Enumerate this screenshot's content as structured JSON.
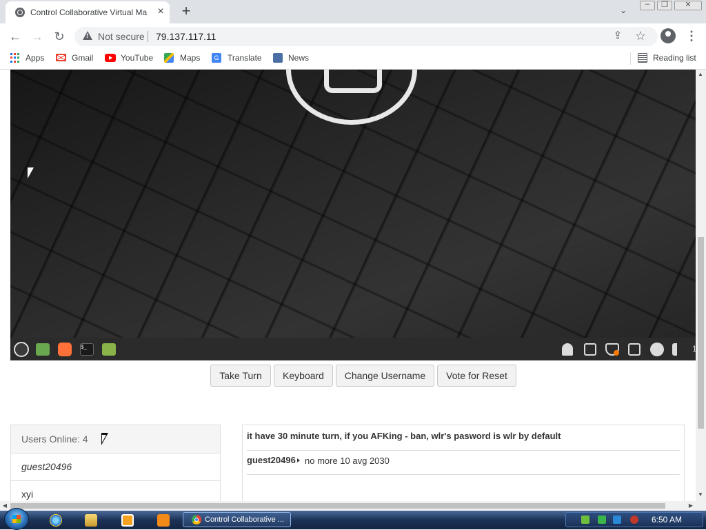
{
  "browser": {
    "tab": {
      "title": "Control Collaborative Virtual Ma",
      "close_icon": "×"
    },
    "new_tab_icon": "+",
    "tab_search_icon": "⌄",
    "window_controls": {
      "minimize": "–",
      "restore": "❐",
      "close": "✕"
    },
    "nav": {
      "back": "←",
      "forward": "→",
      "reload": "↻"
    },
    "omnibox": {
      "security_label": "Not secure",
      "url": "79.137.117.11",
      "share_icon": "⇪",
      "star_icon": "☆"
    },
    "menu_icon": "⋮",
    "bookmarks": [
      {
        "label": "Apps",
        "icon": "apps-grid-icon",
        "color": "#1a73e8"
      },
      {
        "label": "Gmail",
        "icon": "gmail-icon",
        "color": "#ea4335"
      },
      {
        "label": "YouTube",
        "icon": "youtube-icon",
        "color": "#ff0000"
      },
      {
        "label": "Maps",
        "icon": "maps-icon",
        "color": "#34a853"
      },
      {
        "label": "Translate",
        "icon": "translate-icon",
        "color": "#4285f4"
      },
      {
        "label": "News",
        "icon": "news-icon",
        "color": "#5f6368"
      }
    ],
    "reading_list": {
      "label": "Reading list",
      "icon": "reading-list-icon"
    }
  },
  "vm": {
    "panel_left_icons": [
      "mint-menu-icon",
      "show-desktop-icon",
      "firefox-icon",
      "terminal-icon",
      "files-icon"
    ],
    "panel_right_icons": [
      "notifications-icon",
      "clipboard-icon",
      "update-shield-icon",
      "window-icon",
      "power-icon",
      "volume-icon"
    ],
    "panel_right_text": "1"
  },
  "controls": {
    "take_turn": "Take Turn",
    "keyboard": "Keyboard",
    "change_username": "Change Username",
    "vote_reset": "Vote for Reset"
  },
  "users": {
    "header": "Users Online: 4",
    "list": [
      {
        "name": "guest20496",
        "italic": true
      },
      {
        "name": "xyi",
        "italic": false
      }
    ]
  },
  "chat": {
    "notice": "it have 30 minute turn, if you AFKing - ban, wlr's pasword is wlr by default",
    "messages": [
      {
        "user": "guest20496",
        "text": "no more 10 avg 2030"
      }
    ]
  },
  "taskbar": {
    "pinned": [
      "ie-icon",
      "explorer-icon",
      "media-player-icon",
      "app-icon"
    ],
    "active_task": "Control Collaborative ...",
    "clock": "6:50 AM"
  },
  "colors": {
    "taskbar": "#1c3256",
    "vm_panel": "#2b2b2b",
    "firefox": "#ff7139",
    "folder": "#8ab34a"
  }
}
